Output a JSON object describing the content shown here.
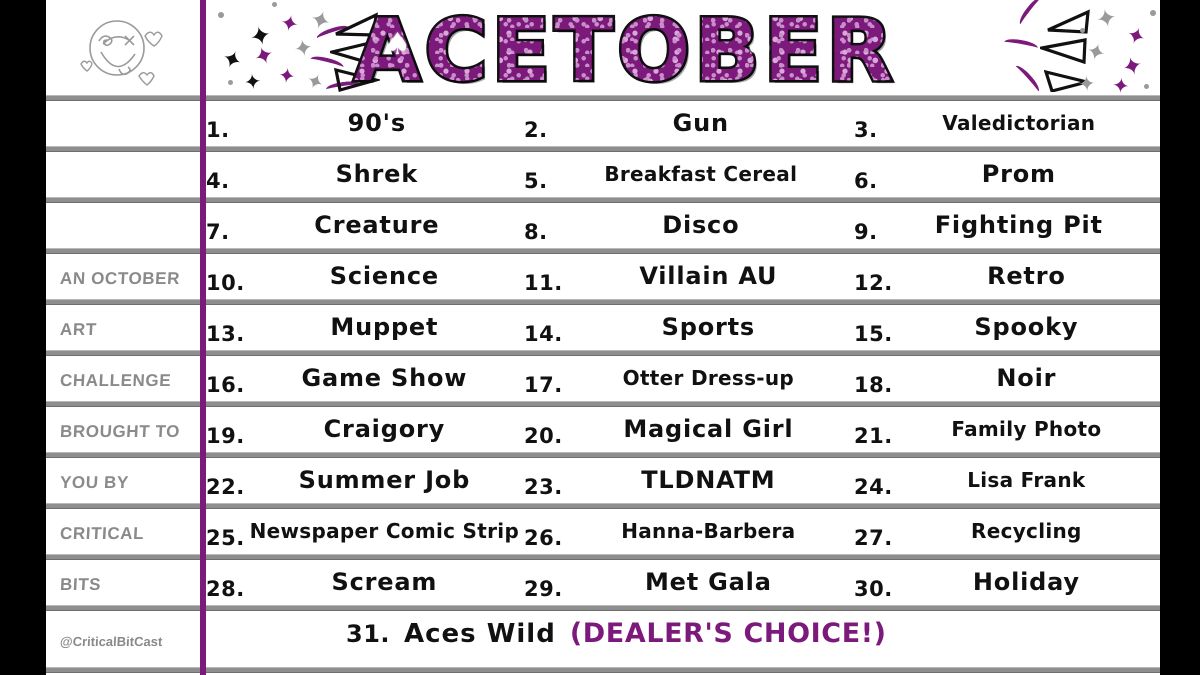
{
  "header": {
    "title": "ACETOBER",
    "logo_icon": "smiling-face-doodle-icon",
    "suit_icons": [
      "spade-icon",
      "club-icon",
      "heart-icon"
    ],
    "title_color": "#7c1a7c",
    "outline_color": "#111111"
  },
  "sidebar": {
    "items": [
      {
        "label": ""
      },
      {
        "label": ""
      },
      {
        "label": ""
      },
      {
        "label": "An October"
      },
      {
        "label": "Art"
      },
      {
        "label": "Challenge"
      },
      {
        "label": "Brought To"
      },
      {
        "label": "You By"
      },
      {
        "label": "Critical"
      },
      {
        "label": "Bits"
      },
      {
        "label": "@CriticalBitCast"
      }
    ]
  },
  "prompts": [
    {
      "num": "1.",
      "label": "90's"
    },
    {
      "num": "2.",
      "label": "Gun"
    },
    {
      "num": "3.",
      "label": "Valedictorian"
    },
    {
      "num": "4.",
      "label": "Shrek"
    },
    {
      "num": "5.",
      "label": "Breakfast Cereal"
    },
    {
      "num": "6.",
      "label": "Prom"
    },
    {
      "num": "7.",
      "label": "Creature"
    },
    {
      "num": "8.",
      "label": "Disco"
    },
    {
      "num": "9.",
      "label": "Fighting Pit"
    },
    {
      "num": "10.",
      "label": "Science"
    },
    {
      "num": "11.",
      "label": "Villain AU"
    },
    {
      "num": "12.",
      "label": "Retro"
    },
    {
      "num": "13.",
      "label": "Muppet"
    },
    {
      "num": "14.",
      "label": "Sports"
    },
    {
      "num": "15.",
      "label": "Spooky"
    },
    {
      "num": "16.",
      "label": "Game Show"
    },
    {
      "num": "17.",
      "label": "Otter Dress-up"
    },
    {
      "num": "18.",
      "label": "Noir"
    },
    {
      "num": "19.",
      "label": "Craigory"
    },
    {
      "num": "20.",
      "label": "Magical Girl"
    },
    {
      "num": "21.",
      "label": "Family Photo"
    },
    {
      "num": "22.",
      "label": "Summer Job"
    },
    {
      "num": "23.",
      "label": "TLDNATM"
    },
    {
      "num": "24.",
      "label": "Lisa Frank"
    },
    {
      "num": "25.",
      "label": "Newspaper Comic Strip"
    },
    {
      "num": "26.",
      "label": "Hanna-Barbera"
    },
    {
      "num": "27.",
      "label": "Recycling"
    },
    {
      "num": "28.",
      "label": "Scream"
    },
    {
      "num": "29.",
      "label": "Met Gala"
    },
    {
      "num": "30.",
      "label": "Holiday"
    }
  ],
  "final_row": {
    "num": "31.",
    "label": "Aces Wild",
    "dealer_note": "(DEALER'S CHOICE!)",
    "dealer_color": "#7c1a7c"
  },
  "colors": {
    "purple": "#7c1a7c",
    "rule_gray": "#8e8e8e",
    "sidebar_text": "#8a8a8a",
    "ink": "#111111",
    "paper": "#ffffff",
    "letterbox": "#000000"
  }
}
